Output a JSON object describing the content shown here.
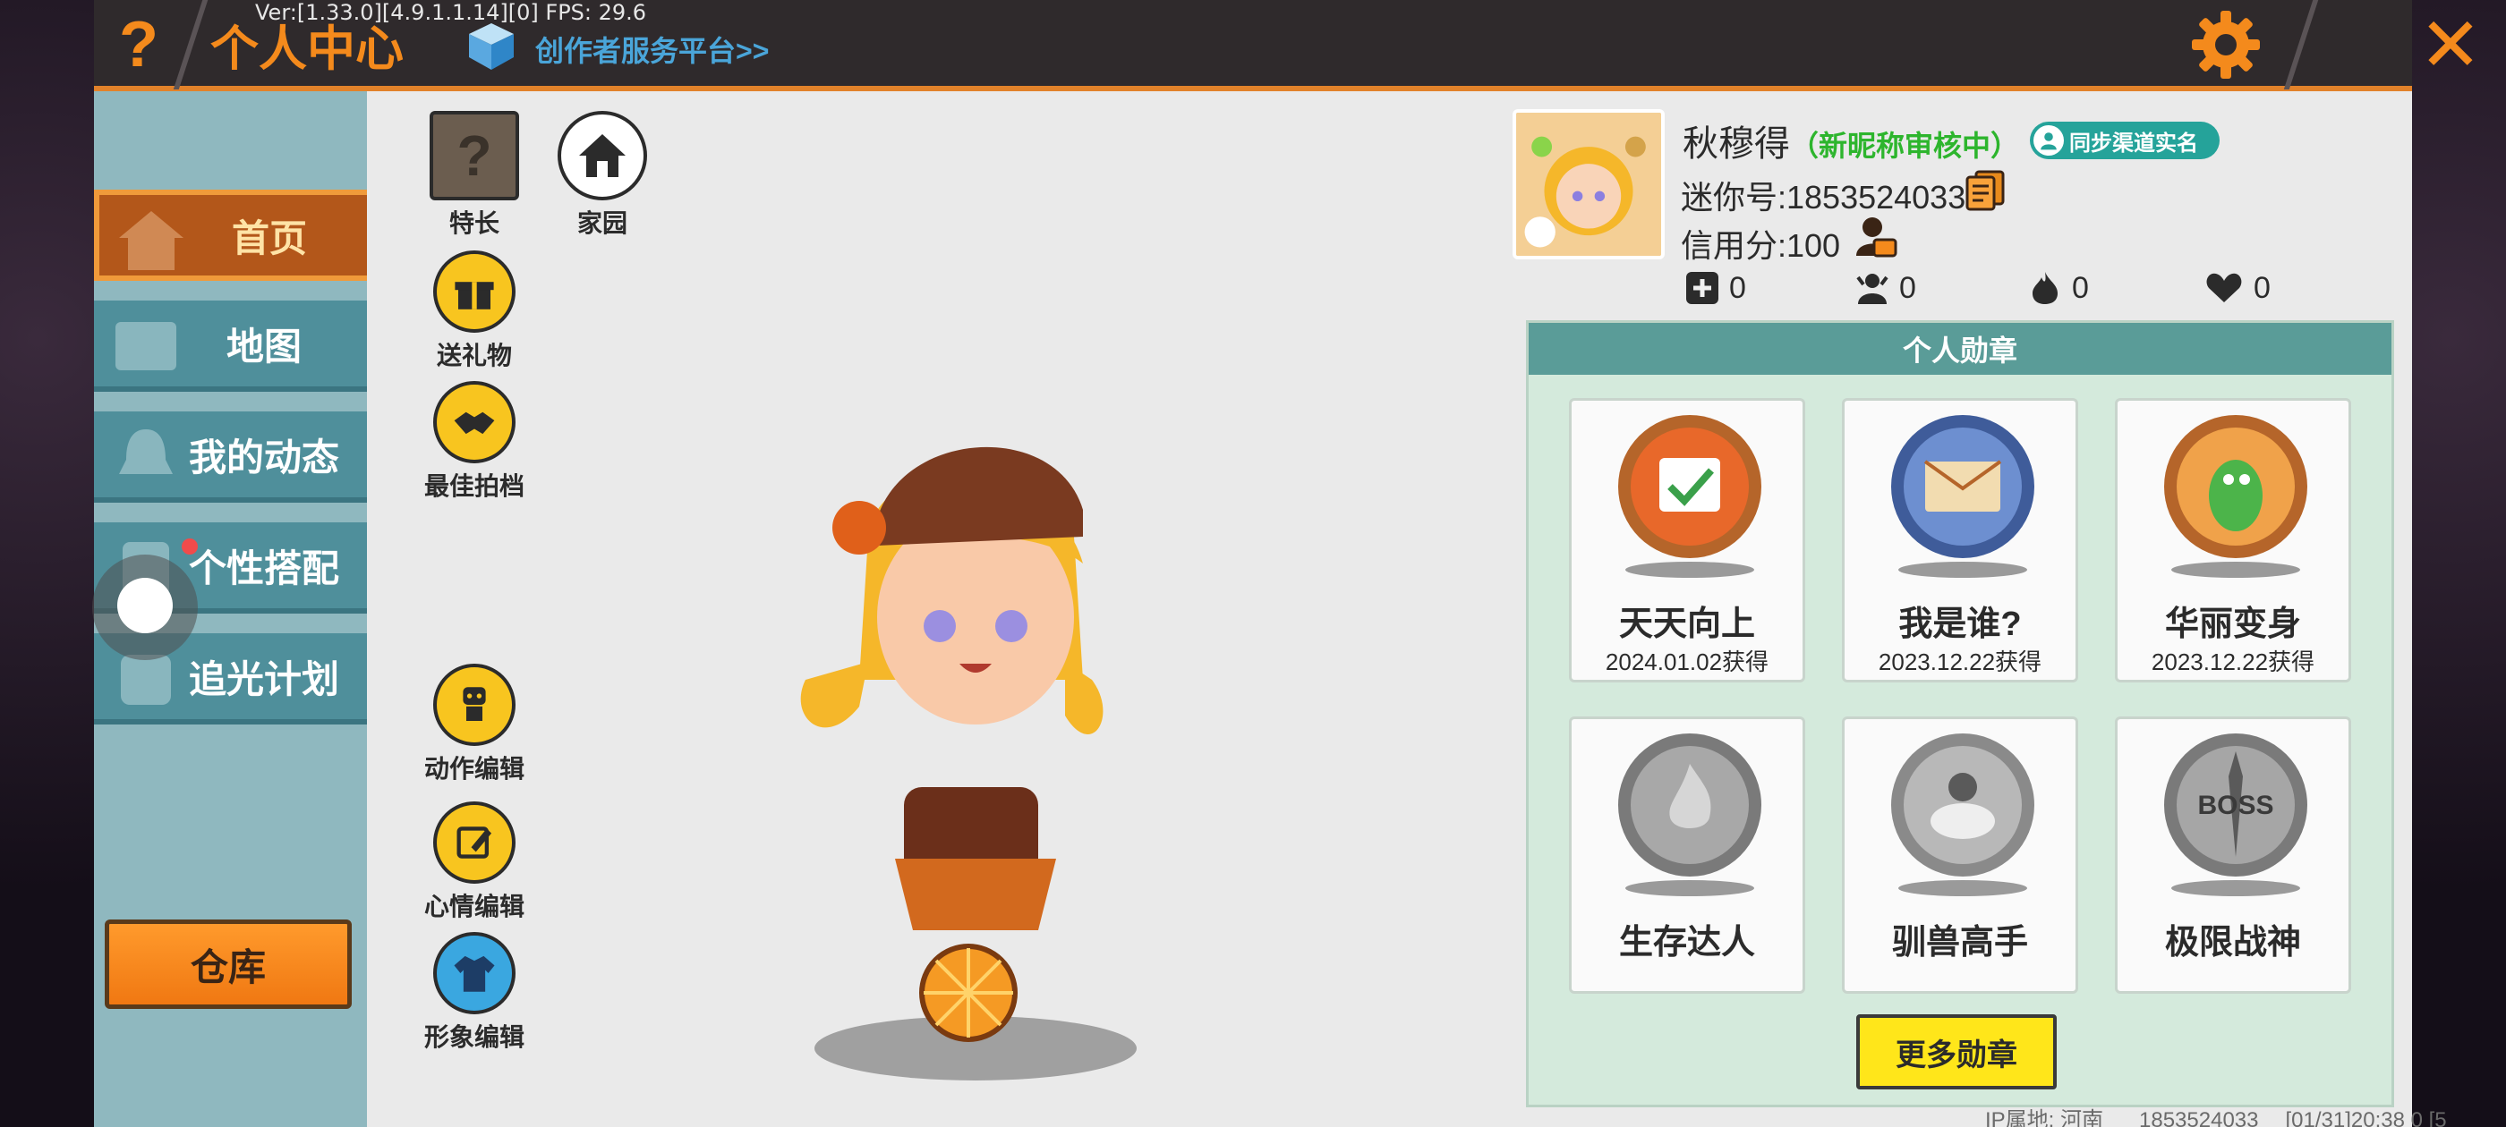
{
  "app": {
    "title": "个人中心",
    "debug": "Ver:[1.33.0][4.9.1.1.14][0] FPS: 29.6",
    "creator_link": "创作者服务平台>>",
    "help_glyph": "?",
    "close_glyph": "✕"
  },
  "sidebar": {
    "items": [
      {
        "label": "首页",
        "icon": "home-icon",
        "active": true
      },
      {
        "label": "地图",
        "icon": "map-icon",
        "active": false
      },
      {
        "label": "我的动态",
        "icon": "bell-icon",
        "active": false
      },
      {
        "label": "个性搭配",
        "icon": "outfit-icon",
        "active": false,
        "red_dot": true
      },
      {
        "label": "追光计划",
        "icon": "lightchase-icon",
        "active": false
      }
    ],
    "warehouse": "仓库"
  },
  "tools": {
    "specialty": "特长",
    "homeland": "家园",
    "send_gift": "送礼物",
    "best_partner": "最佳拍档",
    "action_edit": "动作编辑",
    "mood_edit": "心情编辑",
    "image_edit": "形象编辑"
  },
  "profile": {
    "nickname": "秋穆得",
    "nickname_status": "（新昵称审核中）",
    "sync_label": "同步渠道实名",
    "mini_id": "迷你号:1853524033",
    "credit": "信用分:100",
    "stats": [
      {
        "icon": "add-friend-icon",
        "value": "0"
      },
      {
        "icon": "fans-icon",
        "value": "0"
      },
      {
        "icon": "flame-icon",
        "value": "0"
      },
      {
        "icon": "likes-icon",
        "value": "0"
      }
    ]
  },
  "medals": {
    "header": "个人勋章",
    "items": [
      {
        "name": "天天向上",
        "date": "2024.01.02获得",
        "color": "#e8682a"
      },
      {
        "name": "我是谁?",
        "date": "2023.12.22获得",
        "color": "#5b78b8"
      },
      {
        "name": "华丽变身",
        "date": "2023.12.22获得",
        "color": "#e58a3c"
      },
      {
        "name": "生存达人",
        "date": "",
        "color": "#8a8a8a"
      },
      {
        "name": "驯兽高手",
        "date": "",
        "color": "#9a9a9a"
      },
      {
        "name": "极限战神",
        "date": "",
        "color": "#8e8e8e"
      }
    ],
    "more": "更多勋章"
  },
  "footer": {
    "ip": "IP属地: 河南",
    "uid": "1853524033",
    "time": "[01/31]20:38 0  [5"
  },
  "colors": {
    "accent": "#f48a1c",
    "sidebar": "#4f8f9b",
    "active_tab": "#b3571a",
    "medal_panel": "#d4eadc",
    "more_button": "#ffe61a"
  }
}
